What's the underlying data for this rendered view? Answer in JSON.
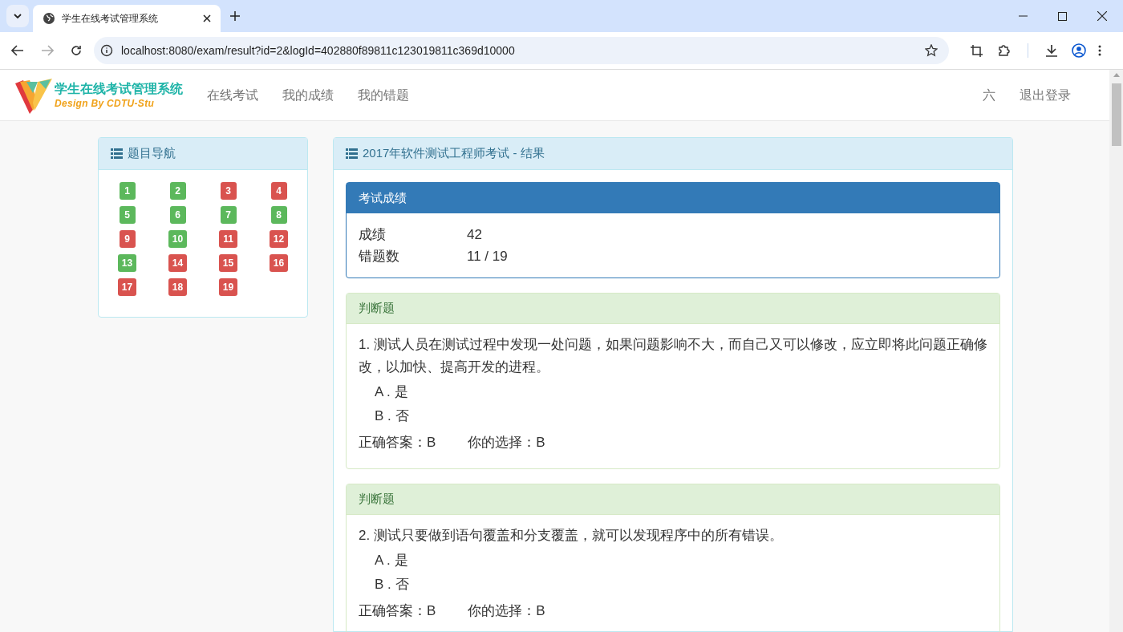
{
  "browser": {
    "tab_title": "学生在线考试管理系统",
    "url": "localhost:8080/exam/result?id=2&logId=402880f89811c123019811c369d10000"
  },
  "navbar": {
    "brand_title": "学生在线考试管理系统",
    "brand_subtitle": "Design By CDTU-Stu",
    "links": [
      "在线考试",
      "我的成绩",
      "我的错题"
    ],
    "user": "六",
    "logout": "退出登录"
  },
  "question_nav": {
    "title": "题目导航",
    "items": [
      {
        "label": "1",
        "correct": true
      },
      {
        "label": "2",
        "correct": true
      },
      {
        "label": "3",
        "correct": false
      },
      {
        "label": "4",
        "correct": false
      },
      {
        "label": "5",
        "correct": true
      },
      {
        "label": "6",
        "correct": true
      },
      {
        "label": "7",
        "correct": true
      },
      {
        "label": "8",
        "correct": true
      },
      {
        "label": "9",
        "correct": false
      },
      {
        "label": "10",
        "correct": true
      },
      {
        "label": "11",
        "correct": false
      },
      {
        "label": "12",
        "correct": false
      },
      {
        "label": "13",
        "correct": true
      },
      {
        "label": "14",
        "correct": false
      },
      {
        "label": "15",
        "correct": false
      },
      {
        "label": "16",
        "correct": false
      },
      {
        "label": "17",
        "correct": false
      },
      {
        "label": "18",
        "correct": false
      },
      {
        "label": "19",
        "correct": false
      }
    ]
  },
  "result": {
    "title": "2017年软件测试工程师考试 - 结果",
    "score_panel": {
      "title": "考试成绩",
      "rows": [
        {
          "label": "成绩",
          "value": "42"
        },
        {
          "label": "错题数",
          "value": "11 / 19"
        }
      ]
    },
    "questions": [
      {
        "type": "判断题",
        "text": "1. 测试人员在测试过程中发现一处问题，如果问题影响不大，而自己又可以修改，应立即将此问题正确修改，以加快、提高开发的进程。",
        "options": [
          "A . 是",
          "B . 否"
        ],
        "answer": "正确答案：B",
        "choice": "你的选择：B"
      },
      {
        "type": "判断题",
        "text": "2. 测试只要做到语句覆盖和分支覆盖，就可以发现程序中的所有错误。",
        "options": [
          "A . 是",
          "B . 否"
        ],
        "answer": "正确答案：B",
        "choice": "你的选择：B"
      }
    ]
  }
}
